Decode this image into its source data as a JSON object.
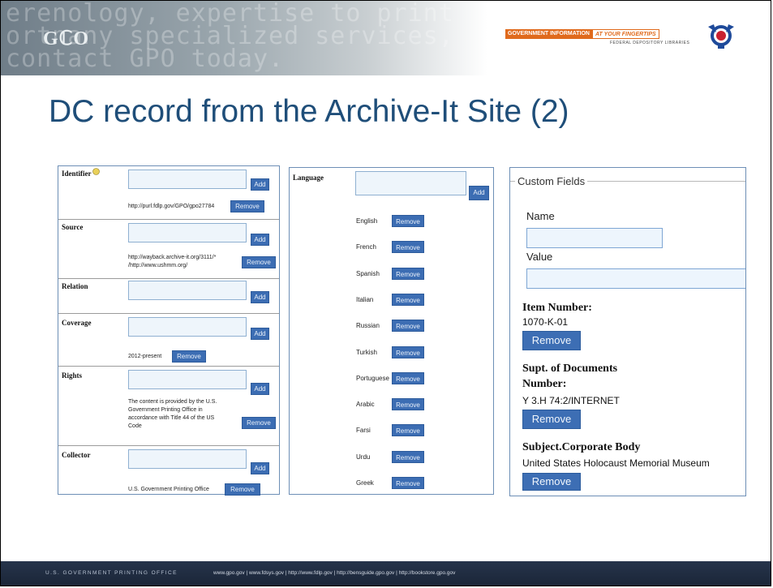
{
  "header": {
    "ghost_lines": [
      "erenology, expertise to print",
      "ortnany specialized services,",
      "contact GPO today."
    ],
    "logo_text": "GℂO",
    "govinfo_a": "GOVERNMENT INFORMATION",
    "govinfo_b": "AT YOUR FINGERTIPS",
    "fdlp": "FEDERAL DEPOSITORY LIBRARIES"
  },
  "slide": {
    "title": "DC record from the Archive-It Site (2)"
  },
  "panel1": {
    "add": "Add",
    "remove": "Remove",
    "sections": [
      {
        "label": "Identifier",
        "value": "http://purl.fdlp.gov/GPO/gpo27784"
      },
      {
        "label": "Source",
        "value_lines": [
          "http://wayback.archive-it.org/3111/*",
          "/http://www.ushmm.org/"
        ]
      },
      {
        "label": "Relation"
      },
      {
        "label": "Coverage",
        "value": "2012-present"
      },
      {
        "label": "Rights",
        "value_lines": [
          "The content is provided by the U.S.",
          "Government Printing Office in",
          "accordance with Title 44 of the US",
          "Code"
        ]
      },
      {
        "label": "Collector",
        "value": "U.S. Government Printing Office"
      }
    ]
  },
  "panel2": {
    "label": "Language",
    "add": "Add",
    "remove": "Remove",
    "languages": [
      "English",
      "French",
      "Spanish",
      "Italian",
      "Russian",
      "Turkish",
      "Portuguese",
      "Arabic",
      "Farsi",
      "Urdu",
      "Greek"
    ]
  },
  "panel3": {
    "legend": "Custom Fields",
    "name_label": "Name",
    "value_label": "Value",
    "remove": "Remove",
    "items": [
      {
        "head_lines": [
          "Item Number:"
        ],
        "value": "1070-K-01"
      },
      {
        "head_lines": [
          "Supt. of Documents",
          "Number:"
        ],
        "value": "Y 3.H 74:2/INTERNET"
      },
      {
        "head_lines": [
          "Subject.Corporate Body"
        ],
        "value": "United States Holocaust Memorial Museum"
      }
    ]
  },
  "footer": {
    "org": "U.S. GOVERNMENT PRINTING OFFICE",
    "links": "www.gpo.gov  |  www.fdsys.gov  |  http://www.fdlp.gov  |  http://bensguide.gpo.gov  |  http://bookstore.gpo.gov"
  },
  "colors": {
    "title": "#1f4e79",
    "button": "#3c6db3",
    "footer": "#1f2b3f",
    "accent": "#e06a1c"
  }
}
